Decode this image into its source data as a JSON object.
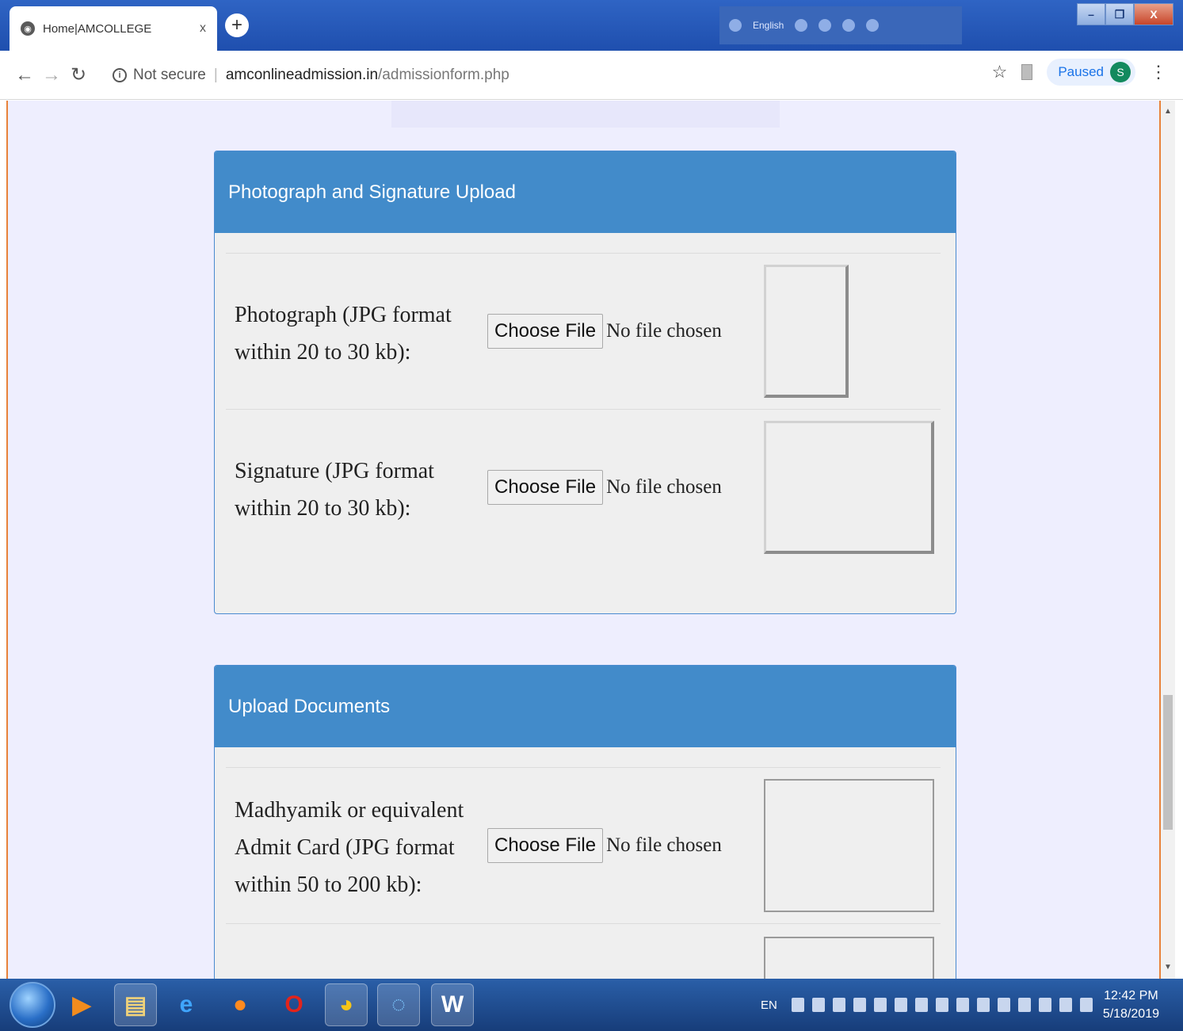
{
  "browser": {
    "tab_title": "Home|AMCOLLEGE",
    "tab_close": "x",
    "new_tab": "+",
    "security_label": "Not secure",
    "url_host": "amconlineadmission.in",
    "url_path": "/admissionform.php",
    "profile_status": "Paused",
    "profile_initial": "S",
    "language_bar": "English",
    "window_controls": [
      "–",
      "❐",
      "X"
    ]
  },
  "photo_panel": {
    "heading": "Photograph and Signature Upload",
    "rows": [
      {
        "label": "Photograph (JPG format within 20 to 30 kb):",
        "button": "Choose File",
        "status": "No file chosen"
      },
      {
        "label": "Signature (JPG format within 20 to 30 kb):",
        "button": "Choose File",
        "status": "No file chosen"
      }
    ]
  },
  "docs_panel": {
    "heading": "Upload Documents",
    "rows": [
      {
        "label": "Madhyamik or equivalent Admit Card (JPG format within 50 to 200 kb):",
        "button": "Choose File",
        "status": "No file chosen"
      }
    ]
  },
  "taskbar": {
    "language": "EN",
    "time": "12:42 PM",
    "date": "5/18/2019",
    "apps": [
      "media-player-icon",
      "file-explorer-icon",
      "internet-explorer-icon",
      "firefox-icon",
      "opera-icon",
      "chrome-icon",
      "browser-icon",
      "word-icon"
    ]
  }
}
